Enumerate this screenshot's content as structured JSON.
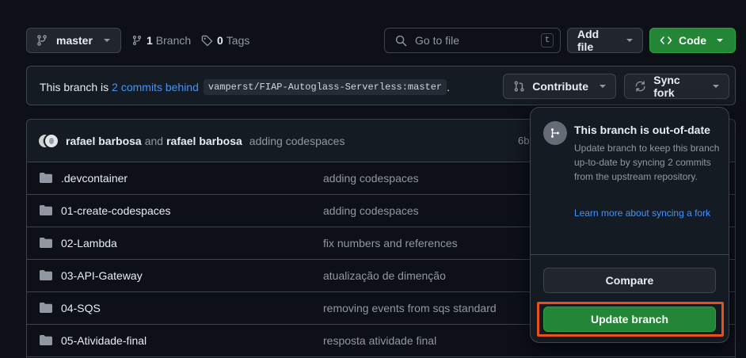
{
  "toolbar": {
    "branch": "master",
    "branch_count": "1",
    "branch_label": "Branch",
    "tag_count": "0",
    "tag_label": "Tags",
    "search_placeholder": "Go to file",
    "search_shortcut": "t",
    "add_file_label": "Add file",
    "code_label": "Code"
  },
  "branch_bar": {
    "prefix": "This branch is",
    "behind_link": "2 commits behind",
    "upstream": "vamperst/FIAP-Autoglass-Serverless:master",
    "suffix": ".",
    "contribute_label": "Contribute",
    "sync_label": "Sync fork"
  },
  "commit": {
    "author1": "rafael barbosa",
    "and_text": "and",
    "author2": "rafael barbosa",
    "message": "adding codespaces",
    "sha_partial": "6b"
  },
  "files": [
    {
      "name": ".devcontainer",
      "message": "adding codespaces"
    },
    {
      "name": "01-create-codespaces",
      "message": "adding codespaces"
    },
    {
      "name": "02-Lambda",
      "message": "fix numbers and references"
    },
    {
      "name": "03-API-Gateway",
      "message": "atualização de dimenção"
    },
    {
      "name": "04-SQS",
      "message": "removing events from sqs standard"
    },
    {
      "name": "05-Atividade-final",
      "message": "resposta atividade final"
    }
  ],
  "popover": {
    "title": "This branch is out-of-date",
    "description": "Update branch to keep this branch up-to-date by syncing 2 commits from the upstream repository.",
    "learn_link": "Learn more about syncing a fork",
    "compare_label": "Compare",
    "update_label": "Update branch"
  },
  "colors": {
    "background": "#0d1117",
    "accent_green": "#238636",
    "link_blue": "#4493f8",
    "highlight": "#e8501e"
  }
}
